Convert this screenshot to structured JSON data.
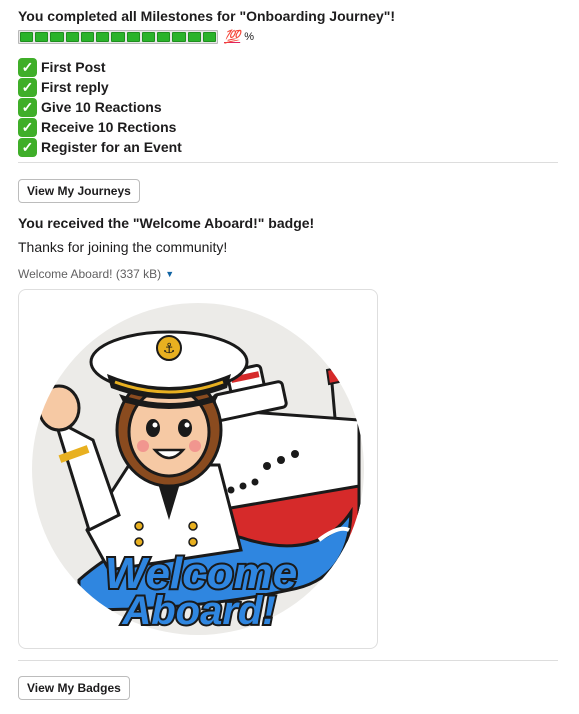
{
  "milestones_message": {
    "heading": "You completed all Milestones for \"Onboarding Journey\"!",
    "progress_percent": 100,
    "progress_segments": 13,
    "hundred_emoji": "💯",
    "percent_sign": "%",
    "check_icon": "white-check-mark-icon",
    "items": [
      {
        "label": "First Post"
      },
      {
        "label": "First reply"
      },
      {
        "label": "Give 10 Reactions"
      },
      {
        "label": "Receive 10 Rections"
      },
      {
        "label": "Register for an Event"
      }
    ],
    "view_journeys_label": "View My Journeys"
  },
  "badge_message": {
    "title": "You received the \"Welcome Aboard!\" badge!",
    "text": "Thanks for joining the community!",
    "file_label": "Welcome Aboard! (337 kB)",
    "caret_icon": "caret-down-icon",
    "image_text_line1": "Welcome",
    "image_text_line2": "Aboard!",
    "view_badges_label": "View My Badges"
  },
  "colors": {
    "progress_fill": "#2bb32b",
    "check_bg": "#3fae29",
    "link_blue": "#1264a3",
    "badge_text_blue": "#2f7fe0"
  }
}
